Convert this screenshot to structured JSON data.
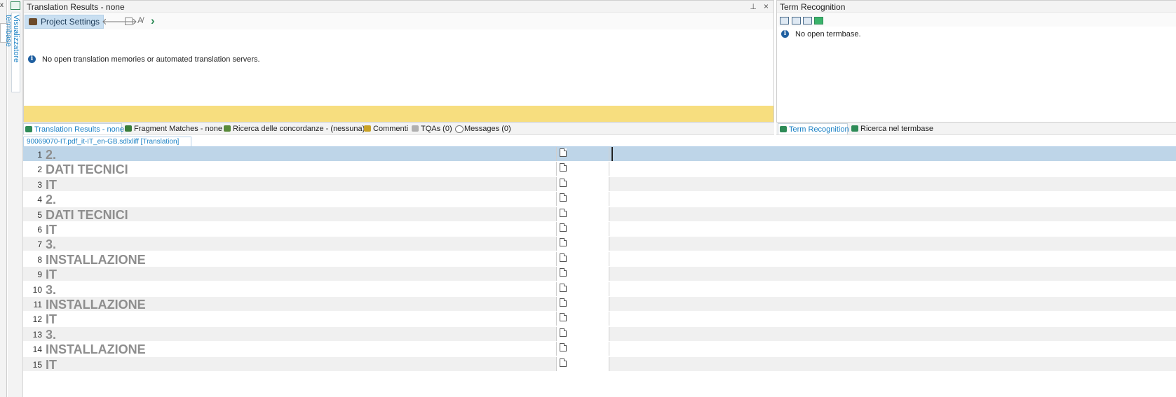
{
  "left_strip": {
    "close_glyph": "x"
  },
  "vertical_tab": {
    "label": "Visualizzatore termbase",
    "icon": "termbase-viewer-icon"
  },
  "translation_results": {
    "title": "Translation Results - none",
    "pin_glyph": "⊥",
    "close_glyph": "×",
    "toolbar": {
      "project_settings_label": "Project Settings",
      "back_glyph": "🡐",
      "forward_glyph": "🡒",
      "next_glyph": "›"
    },
    "message": "No open translation memories or automated translation servers.",
    "info_glyph": "i",
    "yellow_bar_color": "#f7de7f"
  },
  "term_recognition": {
    "title": "Term Recognition",
    "message": "No open termbase.",
    "info_glyph": "i"
  },
  "bottom_tabs_left": [
    {
      "label": "Translation Results - none",
      "active": true,
      "color": "#2e8b57"
    },
    {
      "label": "Fragment Matches - none",
      "active": false,
      "color": "#3a7d3a"
    },
    {
      "label": "Ricerca delle concordanze - (nessuna)",
      "active": false,
      "color": "#5a8a3a"
    },
    {
      "label": "Commenti",
      "active": false,
      "color": "#c9a227"
    },
    {
      "label": "TQAs (0)",
      "active": false,
      "color": "#8a8a8a"
    },
    {
      "label": "Messages (0)",
      "active": false,
      "color": "#777777"
    }
  ],
  "bottom_tabs_right": [
    {
      "label": "Term Recognition",
      "active": true,
      "color": "#2e8b57"
    },
    {
      "label": "Ricerca nel termbase",
      "active": false,
      "color": "#2e8b57"
    }
  ],
  "document_tab": {
    "label": "90069070-IT.pdf_it-IT_en-GB.sdlxliff [Translation]"
  },
  "segments": [
    {
      "num": "1",
      "source": "2.",
      "target": ""
    },
    {
      "num": "2",
      "source": "DATI TECNICI",
      "target": ""
    },
    {
      "num": "3",
      "source": "IT",
      "target": ""
    },
    {
      "num": "4",
      "source": "2.",
      "target": ""
    },
    {
      "num": "5",
      "source": "DATI TECNICI",
      "target": ""
    },
    {
      "num": "6",
      "source": "IT",
      "target": ""
    },
    {
      "num": "7",
      "source": "3.",
      "target": ""
    },
    {
      "num": "8",
      "source": "INSTALLAZIONE",
      "target": ""
    },
    {
      "num": "9",
      "source": "IT",
      "target": ""
    },
    {
      "num": "10",
      "source": "3.",
      "target": ""
    },
    {
      "num": "11",
      "source": "INSTALLAZIONE",
      "target": ""
    },
    {
      "num": "12",
      "source": "IT",
      "target": ""
    },
    {
      "num": "13",
      "source": "3.",
      "target": ""
    },
    {
      "num": "14",
      "source": "INSTALLAZIONE",
      "target": ""
    },
    {
      "num": "15",
      "source": "IT",
      "target": ""
    }
  ],
  "colors": {
    "selected_row": "#bed5e8",
    "accent": "#1a80c4"
  }
}
